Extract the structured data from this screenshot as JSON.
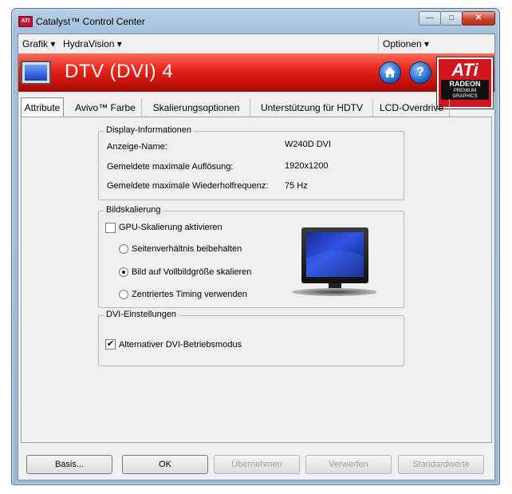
{
  "window": {
    "title": "Catalyst™ Control Center",
    "app_icon_text": "ATI"
  },
  "window_controls": {
    "minimize": "—",
    "maximize": "□",
    "close": "✕"
  },
  "menubar": {
    "grafik": "Grafik ▾",
    "hydravision": "HydraVision ▾",
    "optionen": "Optionen ▾"
  },
  "banner": {
    "title": "DTV (DVI) 4",
    "home_icon": "home-icon",
    "help_icon": "help-icon",
    "logo": {
      "brand": "ATi",
      "product": "RADEON",
      "tier": "PREMIUM GRAPHICS"
    },
    "accent_color": "#e8281c"
  },
  "tabs": [
    {
      "label": "Attribute"
    },
    {
      "label": "Avivo™ Farbe"
    },
    {
      "label": "Skalierungsoptionen"
    },
    {
      "label": "Unterstützung für HDTV"
    },
    {
      "label": "LCD-Overdrive"
    }
  ],
  "display_info": {
    "title": "Display-Informationen",
    "rows": [
      {
        "label": "Anzeige-Name:",
        "value": "W240D DVI"
      },
      {
        "label": "Gemeldete maximale Auflösung:",
        "value": "1920x1200"
      },
      {
        "label": "Gemeldete maximale Wiederholfrequenz:",
        "value": "75 Hz"
      }
    ]
  },
  "scaling": {
    "title": "Bildskalierung",
    "gpu_scaling": {
      "label": "GPU-Skalierung aktivieren",
      "checked": false
    },
    "options": [
      {
        "label": "Seitenverhältnis beibehalten",
        "selected": false
      },
      {
        "label": "Bild auf Vollbildgröße skalieren",
        "selected": true
      },
      {
        "label": "Zentriertes Timing verwenden",
        "selected": false
      }
    ]
  },
  "dvi": {
    "title": "DVI-Einstellungen",
    "alt_mode": {
      "label": "Alternativer DVI-Betriebsmodus",
      "checked": true
    }
  },
  "buttons": {
    "basis": "Basis...",
    "ok": "OK",
    "apply": "Übernehmen",
    "discard": "Verwerfen",
    "defaults": "Standardwerte"
  }
}
